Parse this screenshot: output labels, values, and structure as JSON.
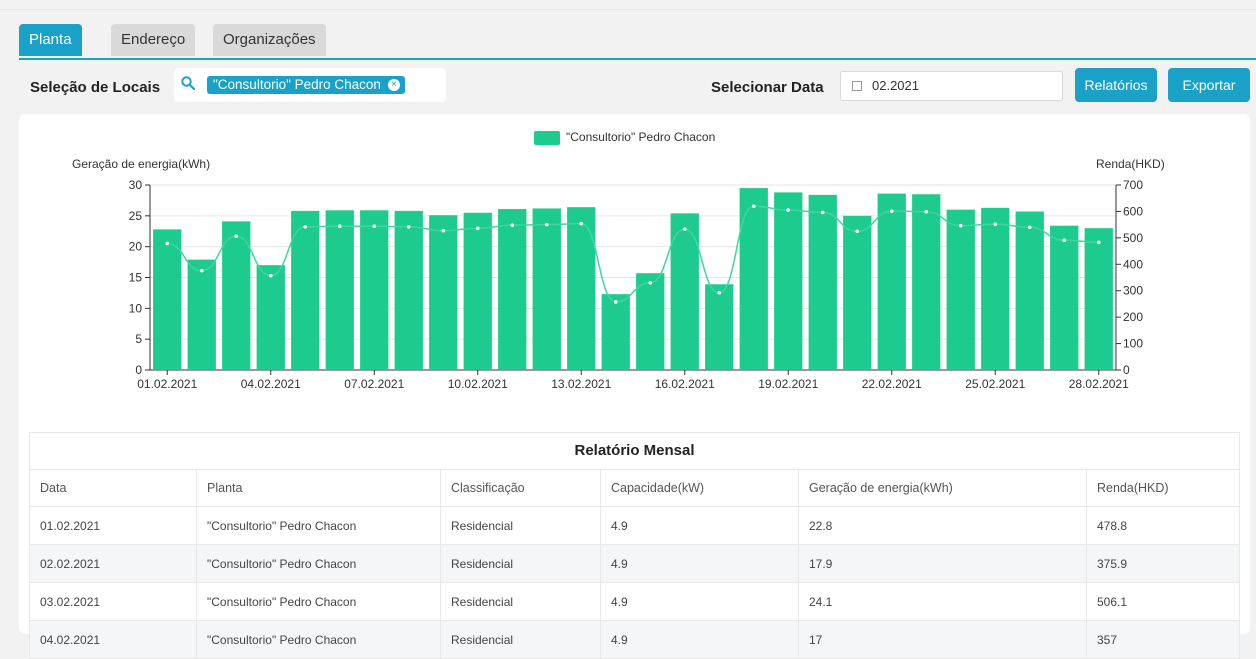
{
  "tabs": [
    {
      "label": "Planta",
      "active": true
    },
    {
      "label": "Endereço",
      "active": false
    },
    {
      "label": "Organizações",
      "active": false
    }
  ],
  "toolbar": {
    "locations_label": "Seleção de Locais",
    "location_chip": "\"Consultorio\" Pedro Chacon",
    "date_label": "Selecionar Data",
    "date_value": "02.2021",
    "reports_button": "Relatórios",
    "export_button": "Exportar"
  },
  "colors": {
    "accent": "#1aa1c7",
    "bar": "#1ecb8e"
  },
  "chart_data": {
    "type": "bar",
    "legend": [
      "\"Consultorio\" Pedro Chacon"
    ],
    "ylabel_left": "Geração de energia(kWh)",
    "ylabel_right": "Renda(HKD)",
    "ylim_left": [
      0,
      30
    ],
    "ylim_right": [
      0,
      700
    ],
    "yticks_left": [
      "0",
      "5",
      "10",
      "15",
      "20",
      "25",
      "30"
    ],
    "yticks_right": [
      "0",
      "100",
      "200",
      "300",
      "400",
      "500",
      "600",
      "700"
    ],
    "xtick_labels": [
      "01.02.2021",
      "04.02.2021",
      "07.02.2021",
      "10.02.2021",
      "13.02.2021",
      "16.02.2021",
      "19.02.2021",
      "22.02.2021",
      "25.02.2021",
      "28.02.2021"
    ],
    "categories": [
      "01.02.2021",
      "02.02.2021",
      "03.02.2021",
      "04.02.2021",
      "05.02.2021",
      "06.02.2021",
      "07.02.2021",
      "08.02.2021",
      "09.02.2021",
      "10.02.2021",
      "11.02.2021",
      "12.02.2021",
      "13.02.2021",
      "14.02.2021",
      "15.02.2021",
      "16.02.2021",
      "17.02.2021",
      "18.02.2021",
      "19.02.2021",
      "20.02.2021",
      "21.02.2021",
      "22.02.2021",
      "23.02.2021",
      "24.02.2021",
      "25.02.2021",
      "26.02.2021",
      "27.02.2021",
      "28.02.2021"
    ],
    "series": [
      {
        "name": "\"Consultorio\" Pedro Chacon",
        "axis": "left",
        "kind": "bar",
        "values": [
          22.8,
          17.9,
          24.1,
          17,
          25.8,
          25.9,
          25.9,
          25.8,
          25.1,
          25.5,
          26.1,
          26.2,
          26.4,
          12.3,
          15.7,
          25.4,
          13.9,
          29.5,
          28.8,
          28.4,
          25.0,
          28.6,
          28.5,
          26.0,
          26.3,
          25.7,
          23.4,
          23.0
        ]
      },
      {
        "name": "Renda",
        "axis": "right",
        "kind": "line",
        "values": [
          478.8,
          375.9,
          506.1,
          357,
          542,
          544,
          544,
          542,
          527,
          536,
          548,
          550,
          554,
          258,
          330,
          533,
          292,
          620,
          605,
          596,
          525,
          601,
          599,
          546,
          552,
          540,
          491,
          483
        ]
      }
    ]
  },
  "report": {
    "title": "Relatório Mensal",
    "columns": [
      "Data",
      "Planta",
      "Classificação",
      "Capacidade(kW)",
      "Geração de energia(kWh)",
      "Renda(HKD)"
    ],
    "rows": [
      [
        "01.02.2021",
        "\"Consultorio\" Pedro Chacon",
        "Residencial",
        "4.9",
        "22.8",
        "478.8"
      ],
      [
        "02.02.2021",
        "\"Consultorio\" Pedro Chacon",
        "Residencial",
        "4.9",
        "17.9",
        "375.9"
      ],
      [
        "03.02.2021",
        "\"Consultorio\" Pedro Chacon",
        "Residencial",
        "4.9",
        "24.1",
        "506.1"
      ],
      [
        "04.02.2021",
        "\"Consultorio\" Pedro Chacon",
        "Residencial",
        "4.9",
        "17",
        "357"
      ]
    ]
  }
}
